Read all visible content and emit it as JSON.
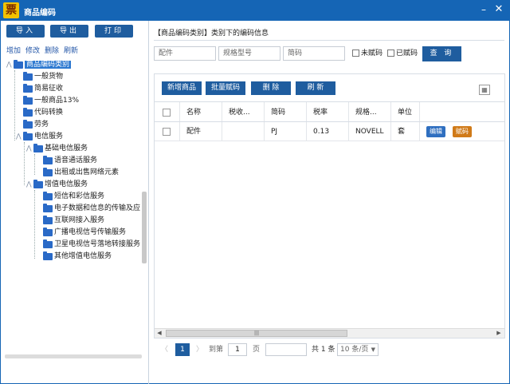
{
  "window": {
    "title": "商品编码",
    "logo_text": "票",
    "minimize": "–",
    "close": "✕"
  },
  "toolbar": {
    "import_label": "导入",
    "export_label": "导出",
    "print_label": "打印"
  },
  "tree_actions": {
    "add": "增加",
    "edit": "修改",
    "delete": "删除",
    "refresh": "刷新"
  },
  "tree": [
    {
      "label": "商品编码类别",
      "selected": true
    },
    {
      "label": "一般货物"
    },
    {
      "label": "简易征收"
    },
    {
      "label": "一般商品13%"
    },
    {
      "label": "代码转换"
    },
    {
      "label": "劳务"
    },
    {
      "label": "电信服务"
    },
    {
      "label": "基础电信服务"
    },
    {
      "label": "语音通话服务"
    },
    {
      "label": "出租或出售网络元素"
    },
    {
      "label": "增值电信服务"
    },
    {
      "label": "短信和彩信服务"
    },
    {
      "label": "电子数据和信息的传输及应"
    },
    {
      "label": "互联网接入服务"
    },
    {
      "label": "广播电视信号传输服务"
    },
    {
      "label": "卫星电视信号落地转接服务"
    },
    {
      "label": "其他增值电信服务"
    }
  ],
  "right_header": "【商品编码类别】类别下的编码信息",
  "search": {
    "name_value": "配件",
    "model_placeholder": "规格型号",
    "code_placeholder": "简码",
    "unassigned_label": "未赋码",
    "assigned_label": "已赋码",
    "query_label": "查 询"
  },
  "grid_toolbar": {
    "add": "新增商品",
    "batch": "批量赋码",
    "delete": "删 除",
    "refresh": "刷 新",
    "columns_icon": "▦"
  },
  "table": {
    "headers": [
      "名称",
      "税收...",
      "简码",
      "税率",
      "规格...",
      "单位"
    ],
    "rows": [
      {
        "name": "配件",
        "tax_code": "",
        "short_code": "PJ",
        "rate": "0.13",
        "spec": "NOVELL",
        "unit": "套",
        "edit": "编辑",
        "assign": "赋码"
      }
    ]
  },
  "pager": {
    "prev": "〈",
    "current": "1",
    "next": "〉",
    "goto_label": "到第",
    "goto_value": "1",
    "page_label": "页",
    "total": "共 1 条",
    "size": "10 条/页",
    "scroll_arrow_left": "◀",
    "scroll_arrow_right": "▶",
    "scroll_grip": "|||"
  },
  "colors": {
    "brand": "#1565b5",
    "button": "#1f5d9f",
    "edit_badge": "#2f6fc0",
    "assign_badge": "#d07a18"
  }
}
